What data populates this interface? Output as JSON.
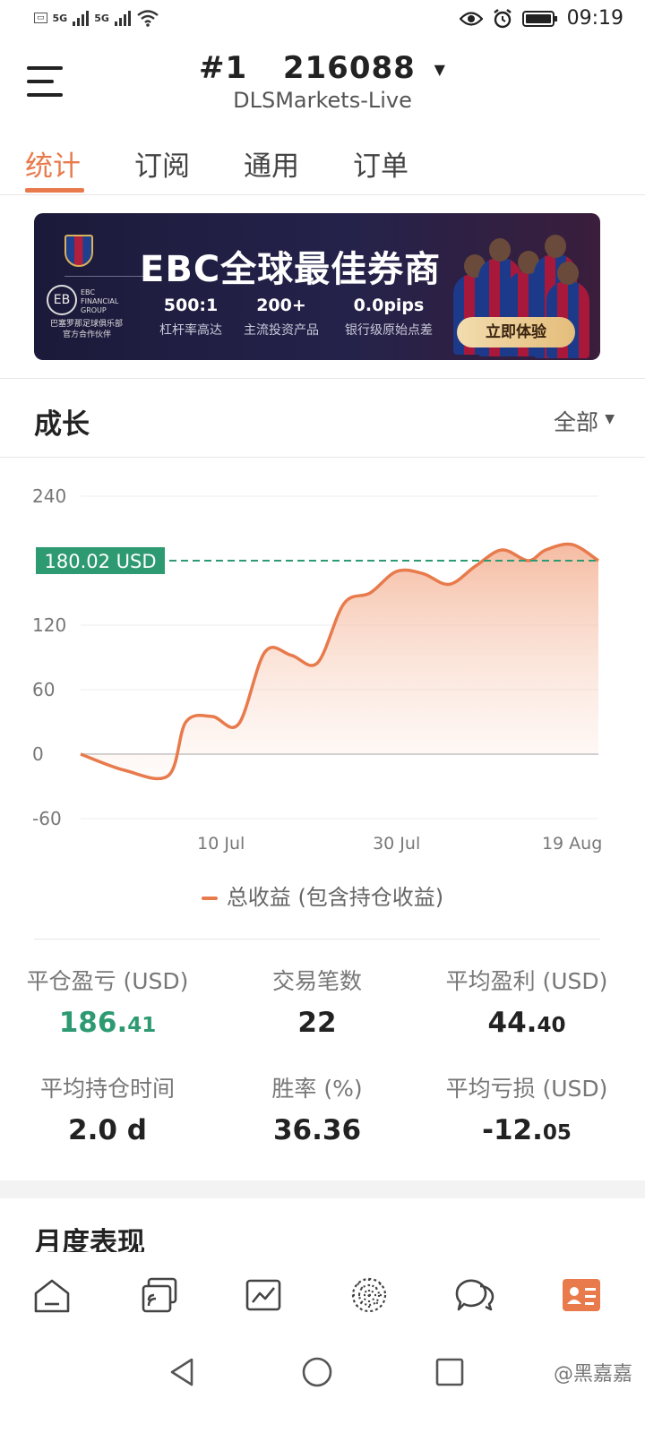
{
  "status_bar": {
    "signal_1_label": "5G",
    "signal_2_label": "5G",
    "time": "09:19"
  },
  "header": {
    "account_prefix": "#1",
    "account_number": "216088",
    "server": "DLSMarkets-Live"
  },
  "tabs": [
    {
      "label": "统计",
      "active": true
    },
    {
      "label": "订阅",
      "active": false
    },
    {
      "label": "通用",
      "active": false
    },
    {
      "label": "订单",
      "active": false
    }
  ],
  "banner": {
    "headline": "EBC全球最佳券商",
    "brand_text_1": "EBC",
    "brand_text_2": "FINANCIAL",
    "brand_text_3": "GROUP",
    "partner_line_1": "巴塞罗那足球俱乐部",
    "partner_line_2": "官方合作伙伴",
    "stats": [
      {
        "value": "500:1",
        "label": "杠杆率高达"
      },
      {
        "value": "200+",
        "label": "主流投资产品"
      },
      {
        "value": "0.0pips",
        "label": "银行级原始点差"
      }
    ],
    "cta": "立即体验"
  },
  "growth": {
    "title": "成长",
    "filter": "全部"
  },
  "chart_data": {
    "type": "area",
    "x_tick_labels": [
      "10 Jul",
      "30 Jul",
      "19 Aug"
    ],
    "y_tick_labels": [
      "240",
      "120",
      "60",
      "0",
      "-60"
    ],
    "y_ticks": [
      240,
      120,
      60,
      0,
      -60
    ],
    "ylim": [
      -60,
      240
    ],
    "x": [
      "2023-06-24",
      "2023-06-29",
      "2023-07-04",
      "2023-07-06",
      "2023-07-09",
      "2023-07-12",
      "2023-07-15",
      "2023-07-18",
      "2023-07-21",
      "2023-07-24",
      "2023-07-27",
      "2023-07-30",
      "2023-08-02",
      "2023-08-05",
      "2023-08-08",
      "2023-08-11",
      "2023-08-14",
      "2023-08-16",
      "2023-08-19",
      "2023-08-22"
    ],
    "values": [
      0,
      -15,
      -20,
      30,
      35,
      28,
      95,
      92,
      85,
      140,
      150,
      170,
      168,
      158,
      175,
      190,
      180,
      190,
      195,
      180
    ],
    "series": [
      {
        "name": "总收益 (包含持仓收益)",
        "color": "#e87a4c"
      }
    ],
    "reference_line": {
      "value": 180.02,
      "label": "180.02 USD",
      "color": "#2e9a72"
    },
    "grid": true,
    "legend": "bottom"
  },
  "stats": [
    {
      "label": "平仓盈亏 (USD)",
      "value_main": "186.",
      "value_small": "41",
      "color": "green"
    },
    {
      "label": "交易笔数",
      "value_main": "22",
      "value_small": "",
      "color": "default"
    },
    {
      "label": "平均盈利 (USD)",
      "value_main": "44.",
      "value_small": "40",
      "color": "default"
    },
    {
      "label": "平均持仓时间",
      "value_main": "2.0 d",
      "value_small": "",
      "color": "default"
    },
    {
      "label": "胜率 (%)",
      "value_main": "36.36",
      "value_small": "",
      "color": "default"
    },
    {
      "label": "平均亏损 (USD)",
      "value_main": "-12.",
      "value_small": "05",
      "color": "default"
    }
  ],
  "monthly": {
    "title": "月度表现"
  },
  "bottom_nav": [
    {
      "icon": "home-icon"
    },
    {
      "icon": "cast-icon"
    },
    {
      "icon": "chart-icon"
    },
    {
      "icon": "network-icon"
    },
    {
      "icon": "chat-icon"
    },
    {
      "icon": "profile-card-icon",
      "active": true
    }
  ],
  "watermark": "@黑嘉嘉",
  "colors": {
    "accent": "#e87a4c",
    "positive": "#2e9a72"
  }
}
